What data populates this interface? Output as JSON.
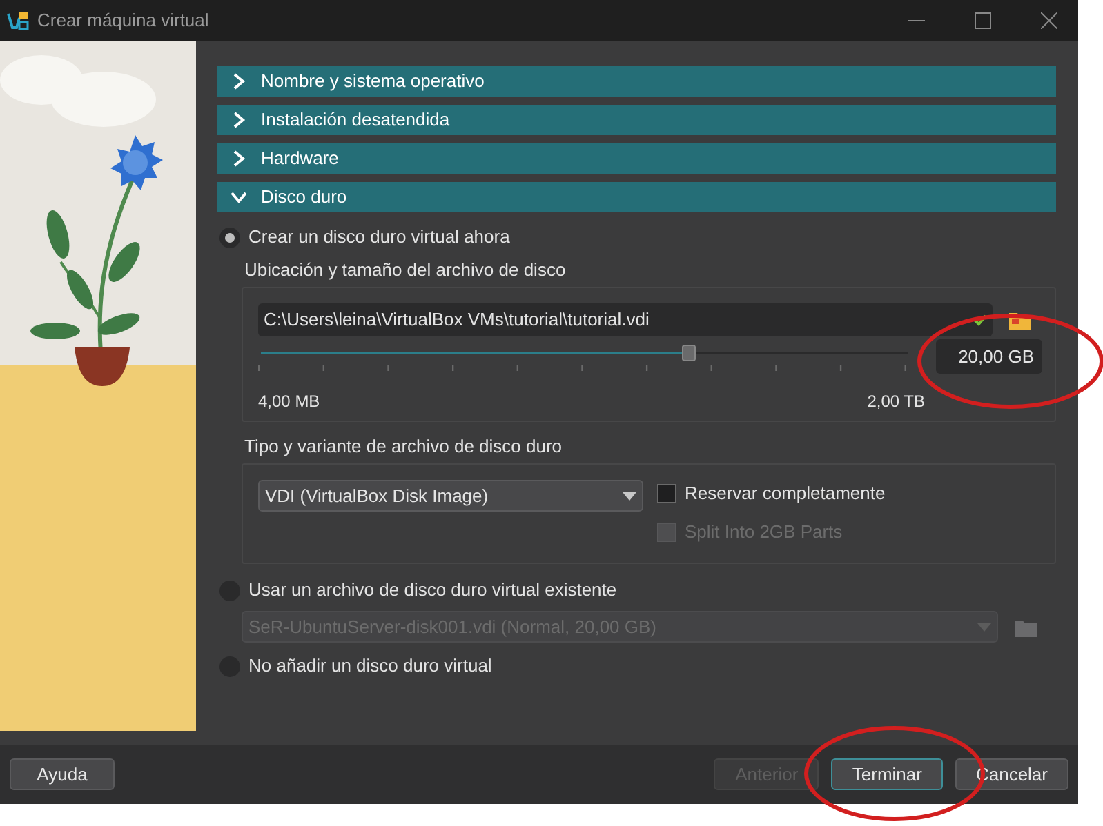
{
  "window": {
    "title": "Crear máquina virtual"
  },
  "sections": [
    {
      "title": "Nombre y sistema operativo",
      "expanded": false
    },
    {
      "title": "Instalación desatendida",
      "expanded": false
    },
    {
      "title": "Hardware",
      "expanded": false
    },
    {
      "title": "Disco duro",
      "expanded": true
    }
  ],
  "disk_options": [
    {
      "kind": "create",
      "label": "Crear un disco duro virtual ahora",
      "selected": true,
      "location_label": "Ubicación y tamaño del archivo de disco",
      "path": "C:\\Users\\leina\\VirtualBox VMs\\tutorial\\tutorial.vdi",
      "size": {
        "level": 0.66,
        "value": "20,00 GB",
        "min_label": "4,00 MB",
        "max_label": "2,00 TB"
      },
      "type_label": "Tipo y variante de archivo de disco duro",
      "format": "VDI (VirtualBox Disk Image)",
      "variants": [
        {
          "label": "Reservar completamente",
          "checked": false,
          "disabled": false
        },
        {
          "label": "Split Into 2GB Parts",
          "checked": false,
          "disabled": true
        }
      ]
    },
    {
      "kind": "existing",
      "label": "Usar un archivo de disco duro virtual existente",
      "selected": false,
      "disk": "SeR-UbuntuServer-disk001.vdi (Normal, 20,00 GB)",
      "disabled": true
    },
    {
      "kind": "none",
      "label": "No añadir un disco duro virtual",
      "selected": false
    }
  ],
  "buttons": [
    {
      "label": "Ayuda",
      "disabled": false,
      "default": false
    },
    {
      "label": "Anterior",
      "disabled": true,
      "default": false
    },
    {
      "label": "Terminar",
      "disabled": false,
      "default": true
    },
    {
      "label": "Cancelar",
      "disabled": false,
      "default": false
    }
  ]
}
